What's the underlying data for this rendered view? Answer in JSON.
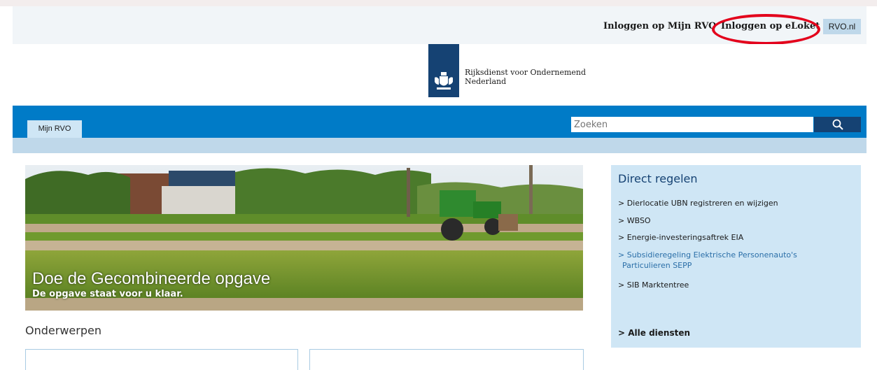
{
  "utility_nav": {
    "login_mijn_rvo": "Inloggen op Mijn RVO",
    "login_eloket": "Inloggen op eLoket",
    "rvo_nl": "RVO.nl"
  },
  "header": {
    "org_name_line1": "Rijksdienst voor Ondernemend",
    "org_name_line2": "Nederland"
  },
  "nav": {
    "tab_mijn_rvo": "Mijn RVO",
    "search_placeholder": "Zoeken"
  },
  "hero": {
    "title": "Doe de Gecombineerde opgave",
    "subtitle": "De opgave staat voor u klaar."
  },
  "section": {
    "onderwerpen": "Onderwerpen"
  },
  "direct_regelen": {
    "title": "Direct regelen",
    "links": [
      "> Dierlocatie UBN registreren en wijzigen",
      "> WBSO",
      "> Energie-investeringsaftrek EIA",
      "> Subsidieregeling Elektrische Personenauto's",
      "Particulieren SEPP",
      "> SIB Marktentree"
    ],
    "all_services": "> Alle diensten"
  },
  "colors": {
    "brand_blue": "#007bc7",
    "dark_blue": "#154273",
    "light_blue": "#cfe6f5",
    "highlight_red": "#e3001b"
  },
  "icons": {
    "search": "search-icon",
    "logo": "rijkswapen-logo"
  }
}
